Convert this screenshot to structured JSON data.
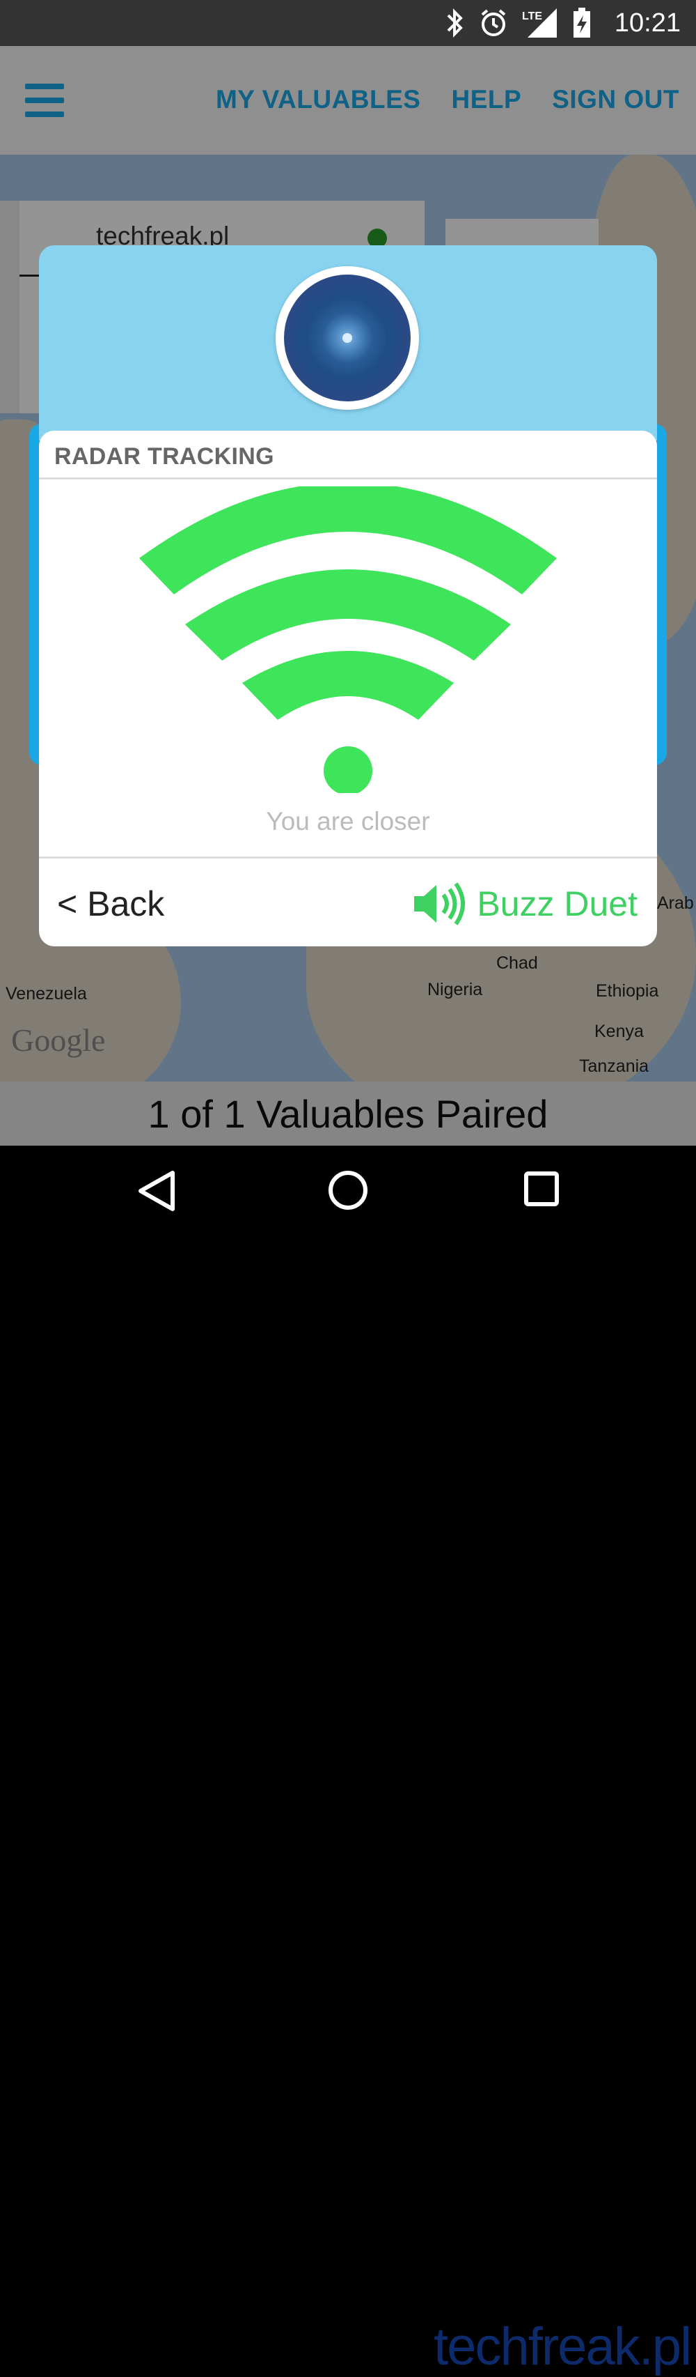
{
  "status_bar": {
    "time": "10:21",
    "network": "LTE",
    "icons": [
      "bluetooth-icon",
      "alarm-icon",
      "signal-icon",
      "battery-charging-icon"
    ]
  },
  "header": {
    "menu_icon": "hamburger-icon",
    "nav": [
      "MY VALUABLES",
      "HELP",
      "SIGN OUT"
    ]
  },
  "device": {
    "name": "techfreak.pl",
    "status_color": "#2a9d2a"
  },
  "map": {
    "labels": [
      "Venezuela",
      "Nigeria",
      "Chad",
      "Ethiopia",
      "Kenya",
      "Tanzania",
      "Arab"
    ],
    "provider": "Google"
  },
  "footer": {
    "paired_text": "1 of 1 Valuables Paired"
  },
  "modal": {
    "title": "RADAR TRACKING",
    "status_message": "You are closer",
    "back_label": "< Back",
    "buzz_label": "Buzz Duet",
    "signal_color": "#3ee45a",
    "accent_color": "#3ed162"
  },
  "system_nav": [
    "back-icon",
    "home-icon",
    "recents-icon"
  ],
  "watermark": "techfreak.pl"
}
